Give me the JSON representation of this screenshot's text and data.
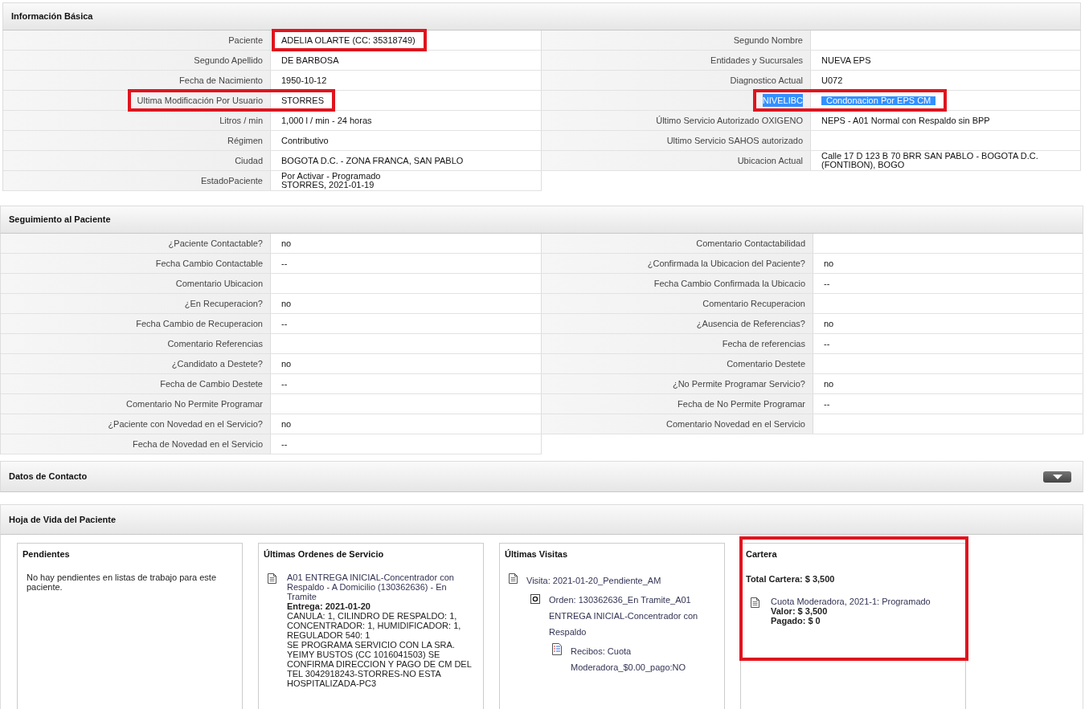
{
  "sections": [
    {
      "kind": "table",
      "title": "Información Básica",
      "left": [
        {
          "label": "Paciente",
          "value": "ADELIA OLARTE (CC: 35318749)",
          "highlighted": true,
          "highlight_label": false,
          "text_selected": false
        },
        {
          "label": "Segundo Apellido",
          "value": "DE BARBOSA",
          "highlighted": false,
          "text_selected": false
        },
        {
          "label": "Fecha de Nacimiento",
          "value": "1950-10-12",
          "highlighted": false,
          "text_selected": false
        },
        {
          "label": "Ultima Modificación Por Usuario",
          "value": "STORRES",
          "highlighted": true,
          "highlight_label": true,
          "text_selected": false
        },
        {
          "label": "Litros / min",
          "value": "1,000 l / min - 24 horas",
          "highlighted": false,
          "text_selected": false
        },
        {
          "label": "Régimen",
          "value": "Contributivo",
          "highlighted": false,
          "text_selected": false
        },
        {
          "label": "Ciudad",
          "value": "BOGOTA D.C. - ZONA FRANCA, SAN PABLO",
          "highlighted": false,
          "text_selected": false
        },
        {
          "label": "EstadoPaciente",
          "value": "Por Activar - Programado\nSTORRES, 2021-01-19",
          "highlighted": false,
          "text_selected": false
        }
      ],
      "right": [
        {
          "label": "Segundo Nombre",
          "highlighted": false,
          "text_selected": false
        },
        {
          "label": "Entidades y Sucursales",
          "value": "NUEVA EPS",
          "highlighted": false,
          "text_selected": false
        },
        {
          "label": "Diagnostico Actual",
          "value": "U072",
          "highlighted": false,
          "text_selected": false
        },
        {
          "label": "NIVELIBC",
          "value": "Condonacion Por EPS CM",
          "highlighted": true,
          "highlight_label": true,
          "text_selected": true
        },
        {
          "label": "Último Servicio Autorizado OXIGENO",
          "value": "NEPS - A01 Normal con Respaldo sin BPP",
          "highlighted": false,
          "text_selected": false
        },
        {
          "label": "Ultimo Servicio SAHOS autorizado",
          "highlighted": false,
          "text_selected": false
        },
        {
          "label": "Ubicacion Actual",
          "value": "Calle 17 D 123 B 70 BRR SAN PABLO - BOGOTA D.C. (FONTIBON), BOGO",
          "highlighted": false,
          "text_selected": false
        }
      ]
    },
    {
      "kind": "table",
      "title": "Seguimiento al Paciente",
      "left": [
        {
          "label": "¿Paciente Contactable?",
          "value": "no",
          "highlighted": false,
          "text_selected": false
        },
        {
          "label": "Fecha Cambio Contactable",
          "value": "--",
          "highlighted": false,
          "text_selected": false
        },
        {
          "label": "Comentario Ubicacion",
          "highlighted": false,
          "text_selected": false
        },
        {
          "label": "¿En Recuperacion?",
          "value": "no",
          "highlighted": false,
          "text_selected": false
        },
        {
          "label": "Fecha Cambio de Recuperacion",
          "value": "--",
          "highlighted": false,
          "text_selected": false
        },
        {
          "label": "Comentario Referencias",
          "highlighted": false,
          "text_selected": false
        },
        {
          "label": "¿Candidato a Destete?",
          "value": "no",
          "highlighted": false,
          "text_selected": false
        },
        {
          "label": "Fecha de Cambio Destete",
          "value": "--",
          "highlighted": false,
          "text_selected": false
        },
        {
          "label": "Comentario No Permite Programar",
          "highlighted": false,
          "text_selected": false
        },
        {
          "label": "¿Paciente con Novedad en el Servicio?",
          "value": "no",
          "highlighted": false,
          "text_selected": false
        },
        {
          "label": "Fecha de Novedad en el Servicio",
          "value": "--",
          "highlighted": false,
          "text_selected": false
        }
      ],
      "right": [
        {
          "label": "Comentario Contactabilidad",
          "highlighted": false,
          "text_selected": false
        },
        {
          "label": "¿Confirmada la Ubicacion del Paciente?",
          "value": "no",
          "highlighted": false,
          "text_selected": false
        },
        {
          "label": "Fecha Cambio Confirmada la Ubicacio",
          "value": "--",
          "highlighted": false,
          "text_selected": false
        },
        {
          "label": "Comentario Recuperacion",
          "highlighted": false,
          "text_selected": false
        },
        {
          "label": "¿Ausencia de Referencias?",
          "value": "no",
          "highlighted": false,
          "text_selected": false
        },
        {
          "label": "Fecha de referencias",
          "value": "--",
          "highlighted": false,
          "text_selected": false
        },
        {
          "label": "Comentario Destete",
          "highlighted": false,
          "text_selected": false
        },
        {
          "label": "¿No Permite Programar Servicio?",
          "value": "no",
          "highlighted": false,
          "text_selected": false
        },
        {
          "label": "Fecha de No Permite Programar",
          "value": "--",
          "highlighted": false,
          "text_selected": false
        },
        {
          "label": "Comentario Novedad en el Servicio",
          "highlighted": false,
          "text_selected": false
        }
      ]
    },
    {
      "kind": "collapsible",
      "title": "Datos de Contacto",
      "expanded": false
    },
    {
      "kind": "cards",
      "title": "Hoja de Vida del Paciente",
      "cards": [
        {
          "kind": "message",
          "title": "Pendientes",
          "highlighted": false,
          "message": "No hay pendientes en listas de trabajo para este paciente."
        },
        {
          "kind": "orders",
          "title": "Últimas Ordenes de Servicio",
          "highlighted": false,
          "items": [
            {
              "link": "A01 ENTREGA INICIAL-Concentrador con Respaldo - A Domicilio (130362636) - En Tramite",
              "delivery": "Entrega: 2021-01-20",
              "details": [
                "CANULA: 1, CILINDRO DE RESPALDO: 1, CONCENTRADOR: 1, HUMIDIFICADOR: 1, REGULADOR 540: 1",
                "SE PROGRAMA SERVICIO CON LA SRA. YEIMY BUSTOS (CC 1016041503) SE CONFIRMA DIRECCION Y PAGO DE CM DEL TEL 3042918243-STORRES-NO ESTA HOSPITALIZADA-PC3"
              ]
            }
          ]
        },
        {
          "kind": "visits",
          "title": "Últimas Visitas",
          "highlighted": false,
          "items": [
            {
              "kind": "visit",
              "text": "Visita: 2021-01-20_Pendiente_AM",
              "children": [
                {
                  "kind": "order",
                  "text": "Orden: 130362636_En Tramite_A01 ENTREGA INICIAL-Concentrador con Respaldo",
                  "children": [
                    {
                      "kind": "receipt",
                      "text": "Recibos: Cuota Moderadora_$0.00_pago:NO"
                    }
                  ]
                }
              ]
            }
          ]
        },
        {
          "kind": "wallet",
          "title": "Cartera",
          "highlighted": true,
          "total": "Total Cartera: $ 3,500",
          "items": [
            {
              "link": "Cuota Moderadora, 2021-1: Programado",
              "lines": [
                "Valor: $ 3,500",
                "Pagado: $ 0"
              ]
            }
          ]
        }
      ]
    }
  ]
}
